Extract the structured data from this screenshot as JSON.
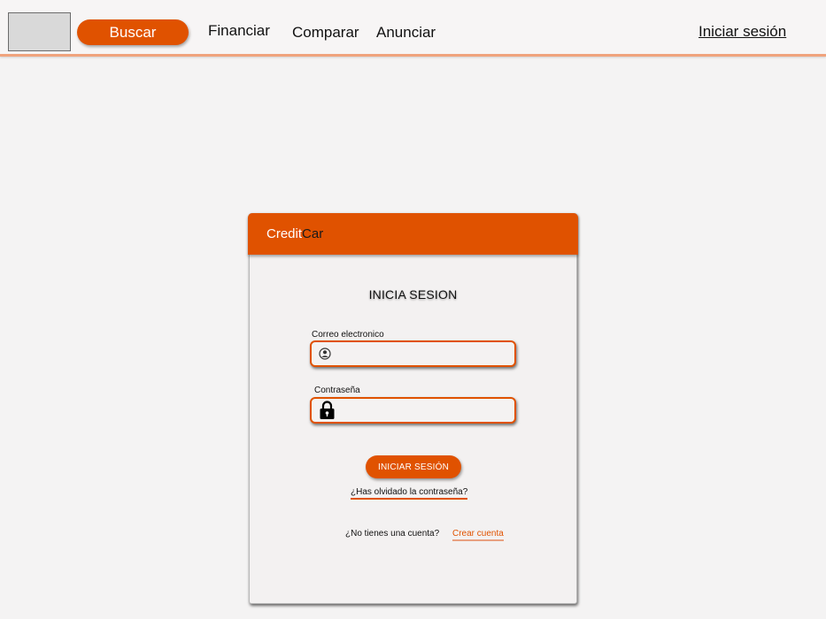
{
  "nav": {
    "search_label": "Buscar",
    "finance_label": "Financiar",
    "compare_label": "Comparar",
    "advertise_label": "Anunciar",
    "login_label": "Iniciar sesión"
  },
  "card": {
    "brand_part1": "Credit",
    "brand_part2": "Car",
    "title": "INICIA SESION",
    "email_label": "Correo electronico",
    "email_value": "",
    "password_label": "Contraseña",
    "password_value": "",
    "login_button": "INICIAR SESIÓN",
    "forgot_link": "¿Has olvidado la contraseña?",
    "no_account_text": "¿No tienes una cuenta?",
    "create_account_link": "Crear cuenta"
  },
  "colors": {
    "accent": "#e05200",
    "nav_underline": "#f0a37d",
    "page_bg": "#f4f3f3",
    "placeholder_box": "#d9d9d9"
  },
  "icons": {
    "email_field": "user-circle-icon",
    "password_field": "lock-icon"
  }
}
